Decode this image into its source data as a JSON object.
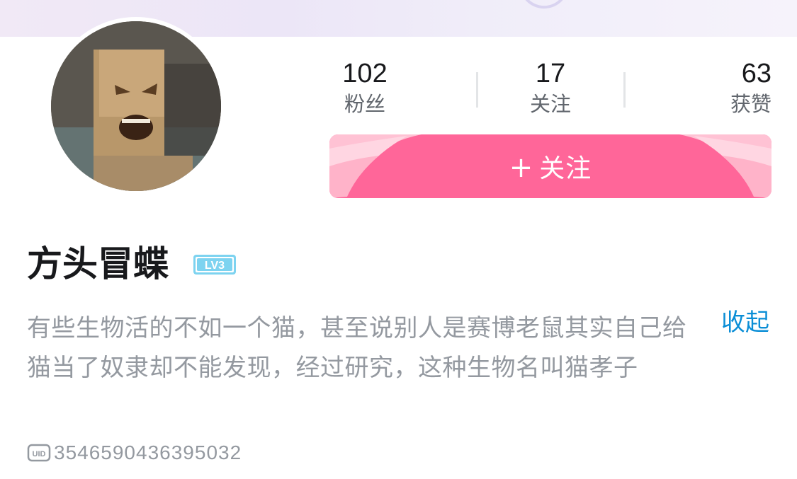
{
  "profile": {
    "username": "方头冒蝶",
    "level": "LV3",
    "bio": "有些生物活的不如一个猫，甚至说别人是赛博老鼠其实自己给猫当了奴隶却不能发现，经过研究，这种生物名叫猫孝子",
    "collapse_label": "收起",
    "uid": "3546590436395032",
    "avatar_icon": "avatar-image",
    "uid_icon": "uid-icon"
  },
  "stats": {
    "fans": {
      "value": "102",
      "label": "粉丝"
    },
    "following": {
      "value": "17",
      "label": "关注"
    },
    "likes": {
      "value": "63",
      "label": "获赞"
    }
  },
  "actions": {
    "follow_plus": "+",
    "follow_label": "关注"
  },
  "colors": {
    "accent_pink": "#ff6699",
    "link_blue": "#0b8ed6",
    "level_badge": "#7dd3f0",
    "muted_text": "#9499a0"
  }
}
